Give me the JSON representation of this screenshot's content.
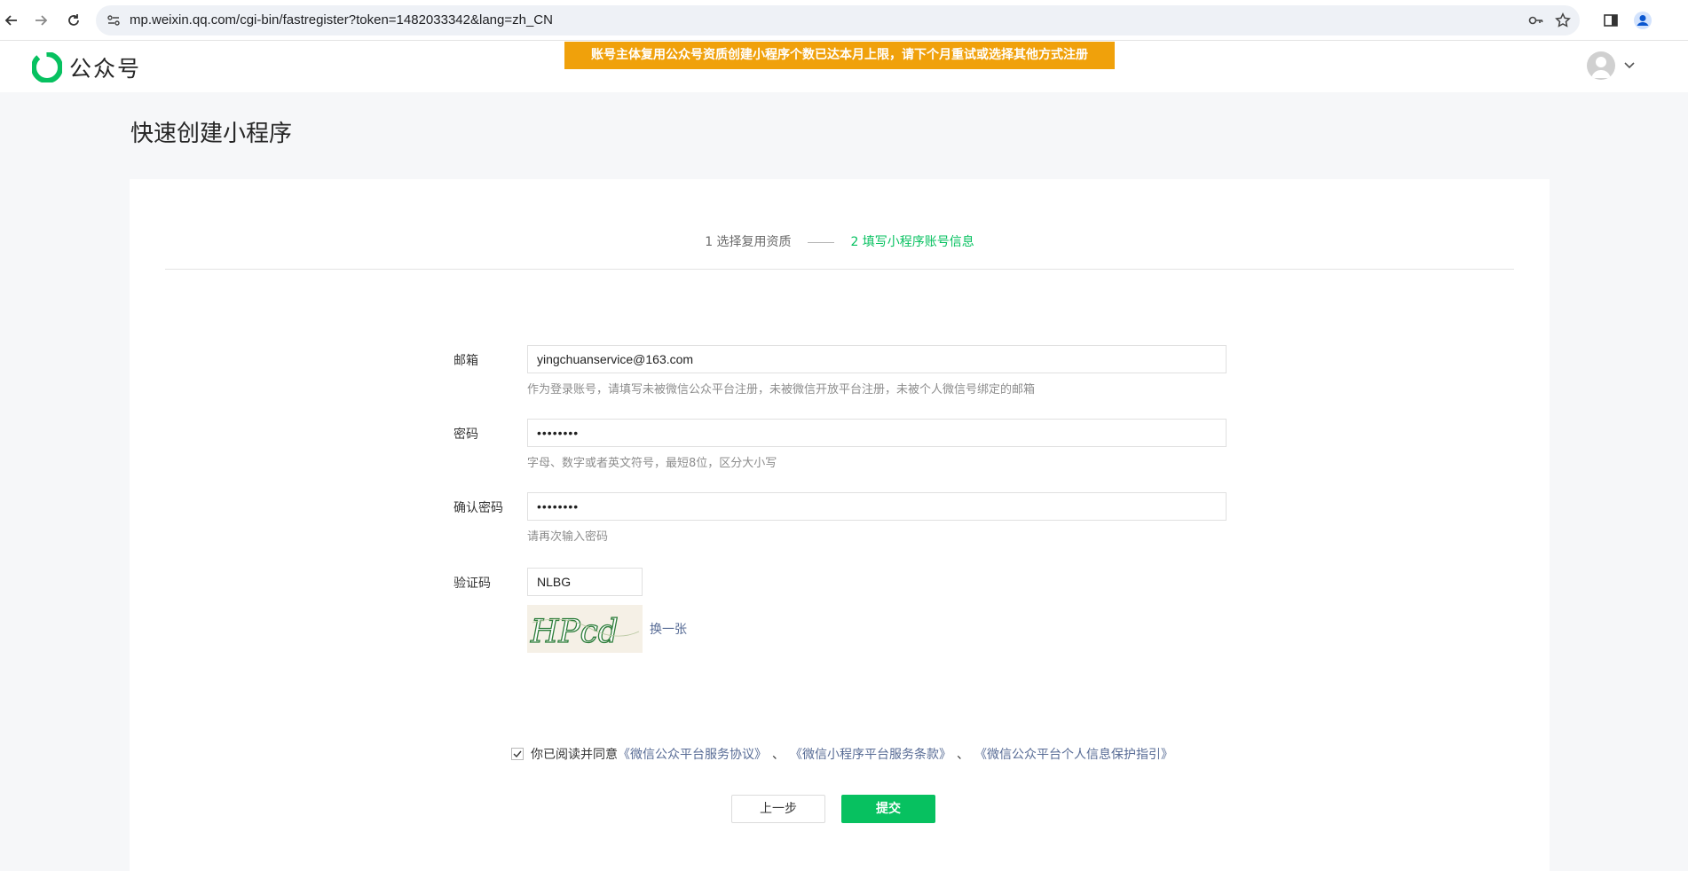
{
  "browser": {
    "url": "mp.weixin.qq.com/cgi-bin/fastregister?token=1482033342&lang=zh_CN"
  },
  "header": {
    "logo_text": "公众号",
    "notice": "账号主体复用公众号资质创建小程序个数已达本月上限，请下个月重试或选择其他方式注册"
  },
  "page": {
    "title": "快速创建小程序"
  },
  "steps": [
    {
      "label": "1 选择复用资质"
    },
    {
      "label": "2 填写小程序账号信息"
    }
  ],
  "form": {
    "email": {
      "label": "邮箱",
      "value": "yingchuanservice@163.com",
      "hint": "作为登录账号，请填写未被微信公众平台注册，未被微信开放平台注册，未被个人微信号绑定的邮箱"
    },
    "password": {
      "label": "密码",
      "value": "••••••••",
      "hint": "字母、数字或者英文符号，最短8位，区分大小写"
    },
    "confirm_password": {
      "label": "确认密码",
      "value": "••••••••",
      "hint": "请再次输入密码"
    },
    "captcha": {
      "label": "验证码",
      "value": "NLBG",
      "image_text": "HPcd",
      "refresh_label": "换一张"
    }
  },
  "agreement": {
    "prefix": "你已阅读并同意",
    "links": [
      "《微信公众平台服务协议》",
      "《微信小程序平台服务条款》",
      "《微信公众平台个人信息保护指引》"
    ],
    "separator": "、",
    "checked": true
  },
  "buttons": {
    "back": "上一步",
    "submit": "提交"
  },
  "colors": {
    "brand_green": "#07c160",
    "notice_bg": "#f0a10b",
    "link": "#576b95"
  }
}
